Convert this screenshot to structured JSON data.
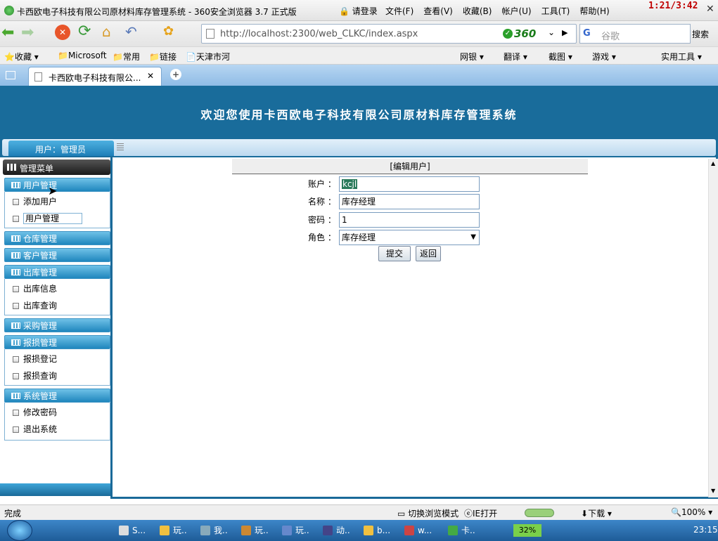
{
  "window": {
    "title": "卡西欧电子科技有限公司原材料库存管理系统 - 360安全浏览器 3.7 正式版",
    "login": "请登录",
    "menu": [
      "文件(F)",
      "查看(V)",
      "收藏(B)",
      "帐户(U)",
      "工具(T)",
      "帮助(H)"
    ],
    "clock_overlay": "1:21/3:42"
  },
  "nav": {
    "url": "http://localhost:2300/web_CLKC/index.aspx",
    "brand": "360",
    "search_placeholder": "谷歌",
    "search_button": "搜索"
  },
  "favorites": {
    "items": [
      "收藏",
      "Microsoft",
      "常用",
      "链接",
      "天津市河"
    ],
    "right_items": [
      "网银",
      "翻译",
      "截图",
      "游戏",
      "实用工具"
    ]
  },
  "tab": {
    "label": "卡西欧电子科技有限公..."
  },
  "app": {
    "banner_title": "欢迎您使用卡西欧电子科技有限公司原材料库存管理系统",
    "user_label": "用户：管理员",
    "menu_title": "管理菜单",
    "sections": [
      {
        "title": "用户管理",
        "items": [
          "添加用户",
          "用户管理"
        ]
      },
      {
        "title": "仓库管理",
        "items": []
      },
      {
        "title": "客户管理",
        "items": []
      },
      {
        "title": "出库管理",
        "items": [
          "出库信息",
          "出库查询"
        ]
      },
      {
        "title": "采购管理",
        "items": []
      },
      {
        "title": "报损管理",
        "items": [
          "报损登记",
          "报损查询"
        ]
      },
      {
        "title": "系统管理",
        "items": [
          "修改密码",
          "退出系统"
        ]
      }
    ],
    "form": {
      "header": "[编辑用户]",
      "account_label": "账户 ：",
      "account_value": "kcjl",
      "name_label": "名称 ：",
      "name_value": "库存经理",
      "password_label": "密码 ：",
      "password_value": "1",
      "role_label": "角色 ：",
      "role_value": "库存经理",
      "submit": "提交",
      "back": "返回"
    }
  },
  "status": {
    "text": "完成",
    "mode": "切换浏览模式",
    "ie_open": "IE打开",
    "download": "下载",
    "zoom": "100%"
  },
  "taskbar": {
    "tasks": [
      "S...",
      "玩..",
      "我..",
      "玩..",
      "玩..",
      "动..",
      "b...",
      "w...",
      "卡.."
    ],
    "cpu": "32%",
    "time": "23:15"
  },
  "colors": {
    "banner": "#196c9b",
    "accent": "#1f86bd"
  }
}
